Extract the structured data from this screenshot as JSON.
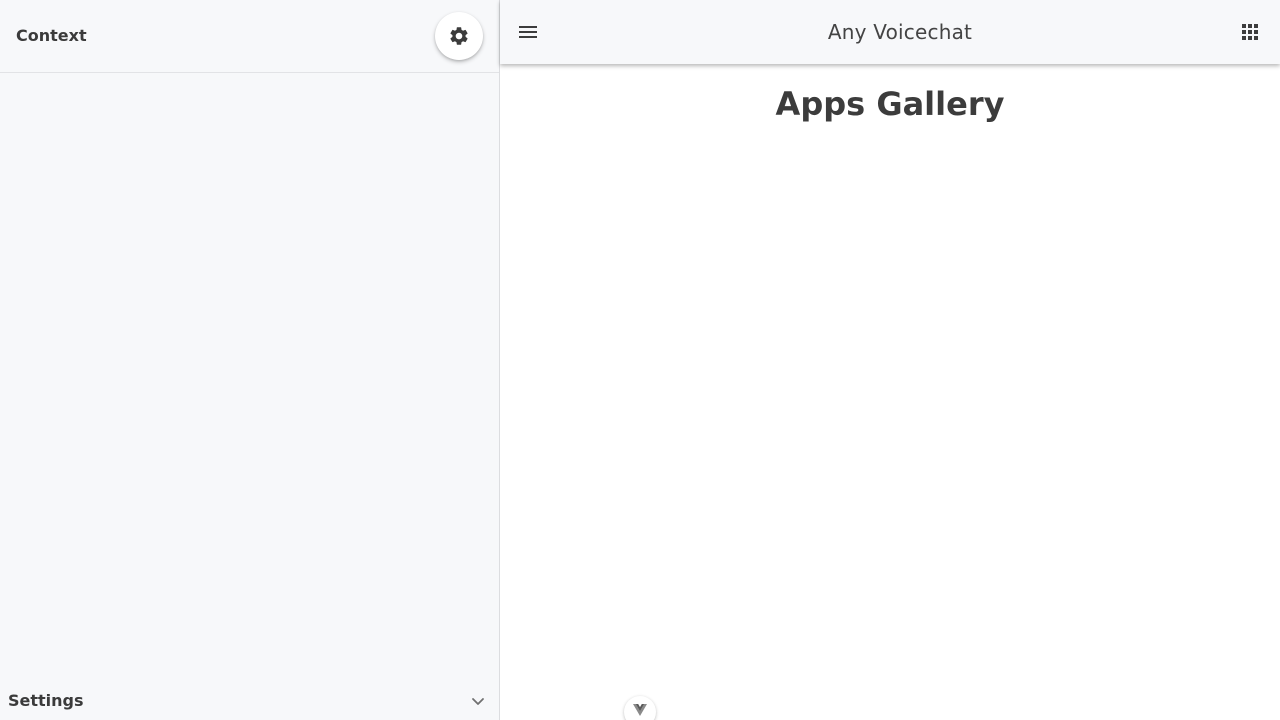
{
  "sidebar": {
    "title": "Context",
    "gear_icon": "gear-icon",
    "settings_label": "Settings",
    "settings_icon": "chevron-down-icon"
  },
  "topbar": {
    "menu_icon": "hamburger-menu-icon",
    "title": "Any Voicechat",
    "apps_icon": "apps-grid-icon"
  },
  "main": {
    "heading": "Apps Gallery"
  },
  "devtools": {
    "icon": "vue-logo-icon"
  },
  "colors": {
    "sidebar_bg": "#f7f8fa",
    "text": "#3c3c3c",
    "main_bg": "#ffffff"
  }
}
